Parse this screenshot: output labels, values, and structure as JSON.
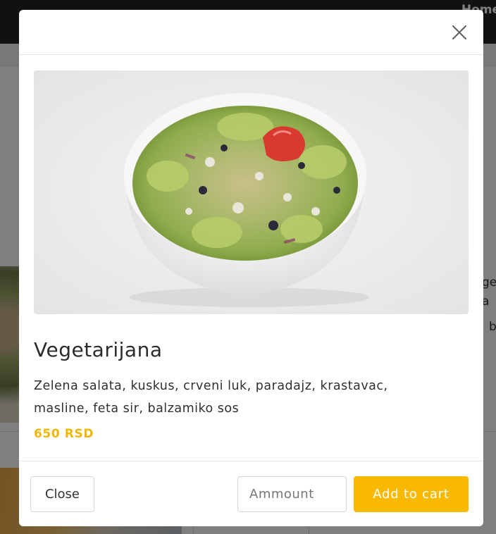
{
  "background": {
    "nav_link": "Home",
    "side_text": [
      "ge",
      "a",
      "b"
    ]
  },
  "modal": {
    "close_icon": "close-icon",
    "image_alt": "salad-bowl-photo",
    "product": {
      "name": "Vegetarijana",
      "description": "Zelena salata, kuskus, crveni luk, paradajz, krastavac, masline, feta sir, balzamiko sos",
      "price": "650 RSD"
    },
    "footer": {
      "close_label": "Close",
      "amount_placeholder": "Ammount",
      "add_label": "Add to cart"
    }
  },
  "colors": {
    "accent": "#f8b900",
    "price": "#f2b705",
    "overlay": "rgba(0,0,0,0.5)"
  }
}
